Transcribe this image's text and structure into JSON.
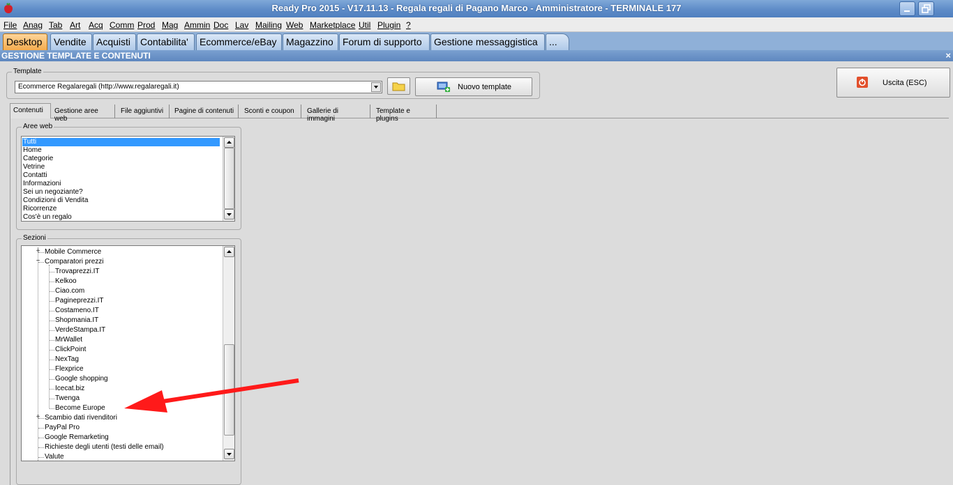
{
  "window": {
    "title": "Ready Pro 2015 - V17.11.13 - Regala regali di Pagano Marco - Amministratore - TERMINALE 177",
    "app_icon": "strawberry-icon"
  },
  "menu": [
    "File",
    "Anag",
    "Tab",
    "Art",
    "Acq",
    "Comm",
    "Prod",
    "Mag",
    "Ammin",
    "Doc",
    "Lav",
    "Mailing",
    "Web",
    "Marketplace",
    "Util",
    "Plugin",
    "?"
  ],
  "main_tabs": [
    "Desktop",
    "Vendite",
    "Acquisti",
    "Contabilita'",
    "Ecommerce/eBay",
    "Magazzino",
    "Forum di supporto",
    "Gestione messaggistica",
    "..."
  ],
  "active_main_tab": "Desktop",
  "panel": {
    "title": "GESTIONE TEMPLATE E CONTENUTI",
    "close": "×"
  },
  "template": {
    "legend": "Template",
    "selected": "Ecommerce Regalaregali (http://www.regalaregali.it)",
    "new_button": "Nuovo template"
  },
  "exit_button": "Uscita (ESC)",
  "sub_tabs": [
    "Contenuti",
    "Gestione aree web",
    "File aggiuntivi",
    "Pagine di contenuti",
    "Sconti e coupon",
    "Gallerie di immagini",
    "Template e plugins"
  ],
  "active_sub_tab": "Contenuti",
  "aree_web": {
    "legend": "Aree web",
    "items": [
      "Tutti",
      "Home",
      "Categorie",
      "Vetrine",
      "Contatti",
      "Informazioni",
      "Sei un negoziante?",
      "Condizioni di Vendita",
      "Ricorrenze",
      "Cos'è un regalo"
    ],
    "selected": "Tutti"
  },
  "sezioni": {
    "legend": "Sezioni",
    "items": [
      {
        "label": "Mobile Commerce",
        "level": 1,
        "expander": "+"
      },
      {
        "label": "Comparatori prezzi",
        "level": 1,
        "expander": "−"
      },
      {
        "label": "Trovaprezzi.IT",
        "level": 2
      },
      {
        "label": "Kelkoo",
        "level": 2
      },
      {
        "label": "Ciao.com",
        "level": 2
      },
      {
        "label": "Pagineprezzi.IT",
        "level": 2
      },
      {
        "label": "Costameno.IT",
        "level": 2
      },
      {
        "label": "Shopmania.IT",
        "level": 2
      },
      {
        "label": "VerdeStampa.IT",
        "level": 2
      },
      {
        "label": "MrWallet",
        "level": 2
      },
      {
        "label": "ClickPoint",
        "level": 2
      },
      {
        "label": "NexTag",
        "level": 2
      },
      {
        "label": "Flexprice",
        "level": 2
      },
      {
        "label": "Google shopping",
        "level": 2
      },
      {
        "label": "Icecat.biz",
        "level": 2
      },
      {
        "label": "Twenga",
        "level": 2
      },
      {
        "label": "Become Europe",
        "level": 2
      },
      {
        "label": "Scambio dati rivenditori",
        "level": 1,
        "expander": "+"
      },
      {
        "label": "PayPal Pro",
        "level": 1
      },
      {
        "label": "Google Remarketing",
        "level": 1
      },
      {
        "label": "Richieste degli utenti (testi delle email)",
        "level": 1
      },
      {
        "label": "Valute",
        "level": 1
      }
    ]
  },
  "annotation": {
    "color": "#ff1a1a",
    "points_to": "Become Europe"
  }
}
